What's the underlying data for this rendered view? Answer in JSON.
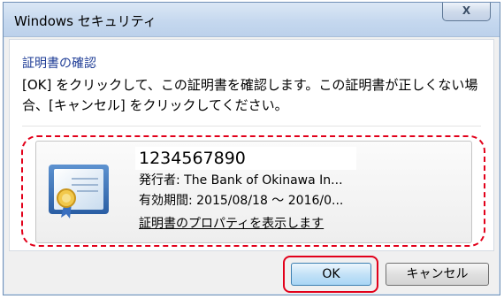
{
  "window": {
    "title": "Windows セキュリティ",
    "close_label": "X"
  },
  "dialog": {
    "heading": "証明書の確認",
    "description": "[OK] をクリックして、この証明書を確認します。この証明書が正しくない場合、[キャンセル] をクリックしてください。"
  },
  "certificate": {
    "name": "1234567890",
    "issuer": "発行者: The Bank of Okinawa In...",
    "validity": "有効期間: 2015/08/18 ～ 2016/0...",
    "properties_link": "証明書のプロパティを表示します",
    "icon": "certificate-icon"
  },
  "buttons": {
    "ok_label": "OK",
    "cancel_label": "キャンセル"
  },
  "colors": {
    "highlight": "#e2001a",
    "heading": "#1e3c96"
  }
}
